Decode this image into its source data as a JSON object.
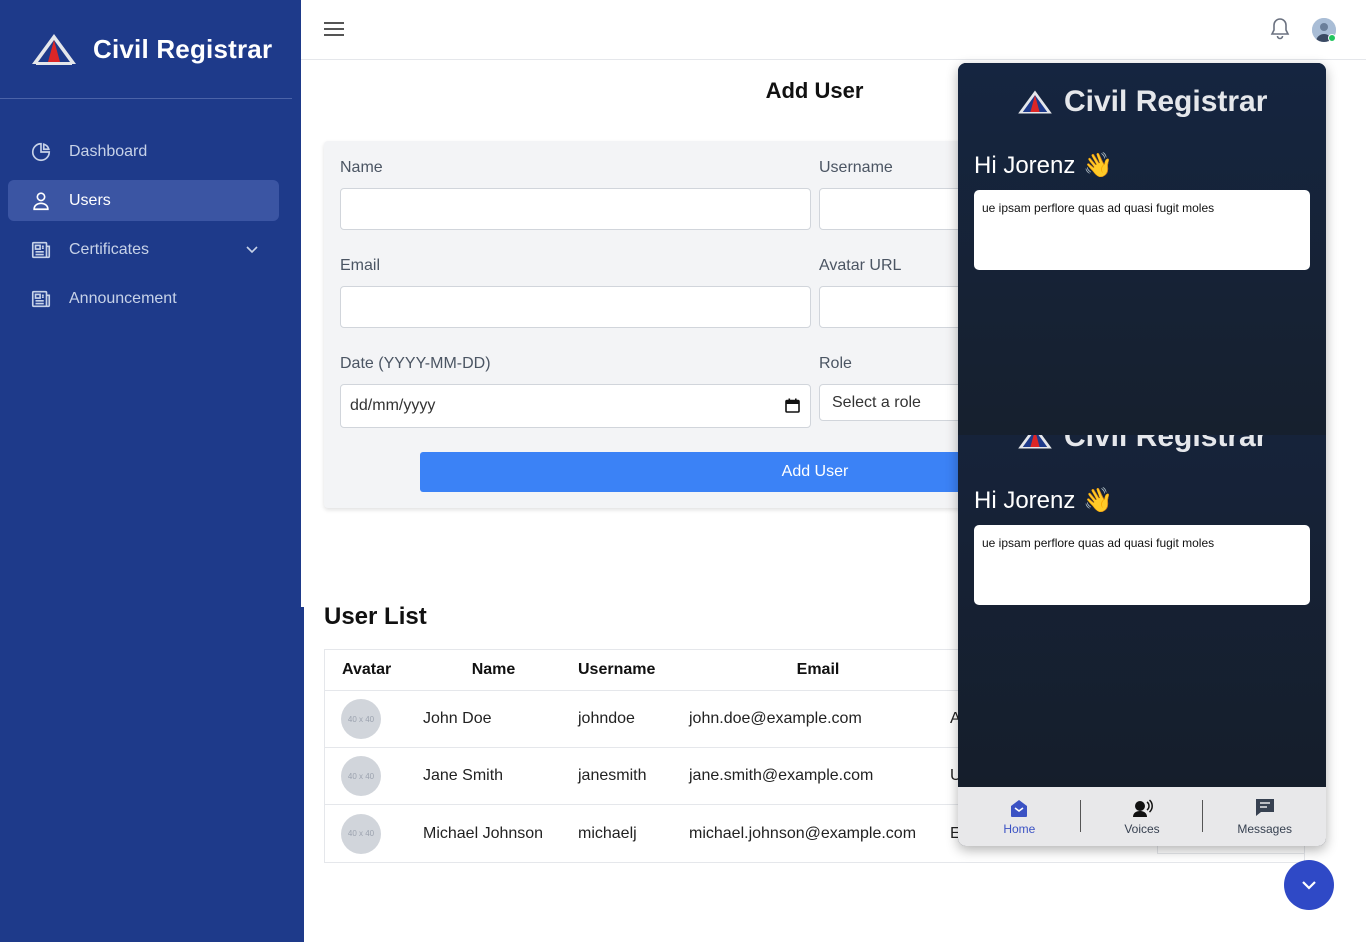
{
  "app": {
    "name": "Civil Registrar"
  },
  "sidebar": {
    "items": [
      {
        "label": "Dashboard",
        "icon": "pie-chart-icon",
        "active": false
      },
      {
        "label": "Users",
        "icon": "user-icon",
        "active": true
      },
      {
        "label": "Certificates",
        "icon": "newspaper-icon",
        "active": false,
        "has_submenu": true
      },
      {
        "label": "Announcement",
        "icon": "newspaper-icon",
        "active": false
      }
    ]
  },
  "topbar": {
    "menu_icon": "hamburger-icon",
    "notification_icon": "bell-icon",
    "status_color": "#22c55e"
  },
  "form": {
    "title": "Add User",
    "fields": {
      "name": {
        "label": "Name",
        "value": ""
      },
      "username": {
        "label": "Username",
        "value": ""
      },
      "email": {
        "label": "Email",
        "value": ""
      },
      "avatar_url": {
        "label": "Avatar URL",
        "value": ""
      },
      "date": {
        "label": "Date (YYYY-MM-DD)",
        "placeholder": "dd/mm/yyyy"
      },
      "role": {
        "label": "Role",
        "selected": "Select a role"
      }
    },
    "submit_label": "Add User"
  },
  "user_list": {
    "title": "User List",
    "columns": [
      "Avatar",
      "Name",
      "Username",
      "Email"
    ],
    "avatar_placeholder": "40 x 40",
    "rows": [
      {
        "name": "John Doe",
        "username": "johndoe",
        "email": "john.doe@example.com",
        "role_fragment": "A"
      },
      {
        "name": "Jane Smith",
        "username": "janesmith",
        "email": "jane.smith@example.com",
        "role_fragment": "U"
      },
      {
        "name": "Michael Johnson",
        "username": "michaelj",
        "email": "michael.johnson@example.com",
        "role_fragment": "E"
      }
    ]
  },
  "chat_widget": {
    "brand": "Civil Registrar",
    "greeting": "Hi Jorenz",
    "greeting_emoji": "👋",
    "message": "ue ipsam perflore quas ad quasi fugit moles",
    "tabs": [
      {
        "label": "Home",
        "icon": "home-icon",
        "active": true
      },
      {
        "label": "Voices",
        "icon": "voice-icon",
        "active": false
      },
      {
        "label": "Messages",
        "icon": "message-icon",
        "active": false
      }
    ],
    "toggle_icon": "chevron-down-icon",
    "accent_color": "#2f49c6"
  }
}
